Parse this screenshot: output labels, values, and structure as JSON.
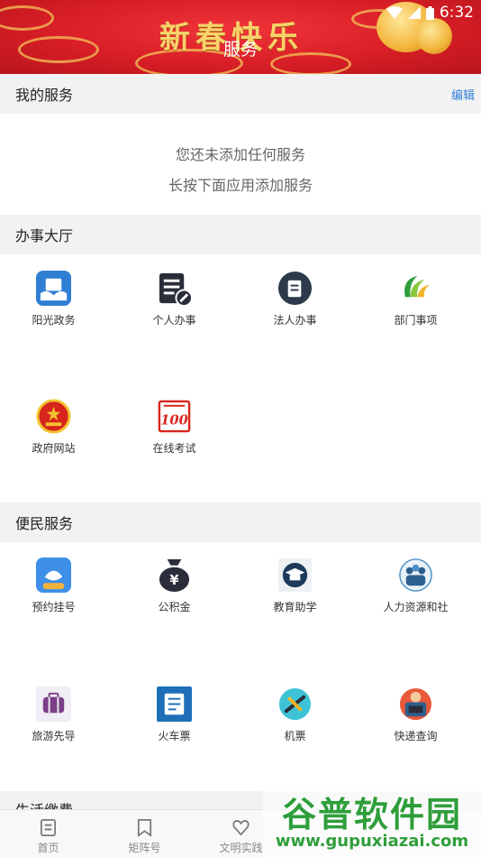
{
  "status_bar": {
    "time": "6:32"
  },
  "banner": {
    "text": "新春快乐"
  },
  "page": {
    "title": "服务"
  },
  "my_services": {
    "title": "我的服务",
    "edit_label": "编辑",
    "empty_line1": "您还未添加任何服务",
    "empty_line2": "长按下面应用添加服务"
  },
  "hall": {
    "title": "办事大厅",
    "items": [
      {
        "label": "阳光政务",
        "icon": "sunshine-affairs-icon"
      },
      {
        "label": "个人办事",
        "icon": "personal-affairs-icon"
      },
      {
        "label": "法人办事",
        "icon": "corporate-affairs-icon"
      },
      {
        "label": "部门事项",
        "icon": "department-items-icon"
      },
      {
        "label": "政府网站",
        "icon": "government-emblem-icon"
      },
      {
        "label": "在线考试",
        "icon": "online-exam-icon"
      }
    ]
  },
  "convenience": {
    "title": "便民服务",
    "items": [
      {
        "label": "预约挂号",
        "icon": "appointment-icon"
      },
      {
        "label": "公积金",
        "icon": "housing-fund-icon"
      },
      {
        "label": "教育助学",
        "icon": "education-icon"
      },
      {
        "label": "人力资源和社",
        "icon": "human-resources-icon"
      },
      {
        "label": "旅游先导",
        "icon": "travel-icon"
      },
      {
        "label": "火车票",
        "icon": "train-ticket-icon"
      },
      {
        "label": "机票",
        "icon": "plane-ticket-icon"
      },
      {
        "label": "快递查询",
        "icon": "express-query-icon"
      }
    ]
  },
  "next_section": {
    "title": "生活缴费"
  },
  "tabbar": {
    "tabs": [
      {
        "label": "首页",
        "icon": "home-icon"
      },
      {
        "label": "矩阵号",
        "icon": "bookmark-icon"
      },
      {
        "label": "文明实践",
        "icon": "heart-icon"
      }
    ]
  },
  "watermark": {
    "main": "谷普软件园",
    "sub": "www.gupuxiazai.com"
  },
  "colors": {
    "accent": "#2e7fd6",
    "banner_red": "#d81e26",
    "section_bg": "#f2f2f2"
  }
}
